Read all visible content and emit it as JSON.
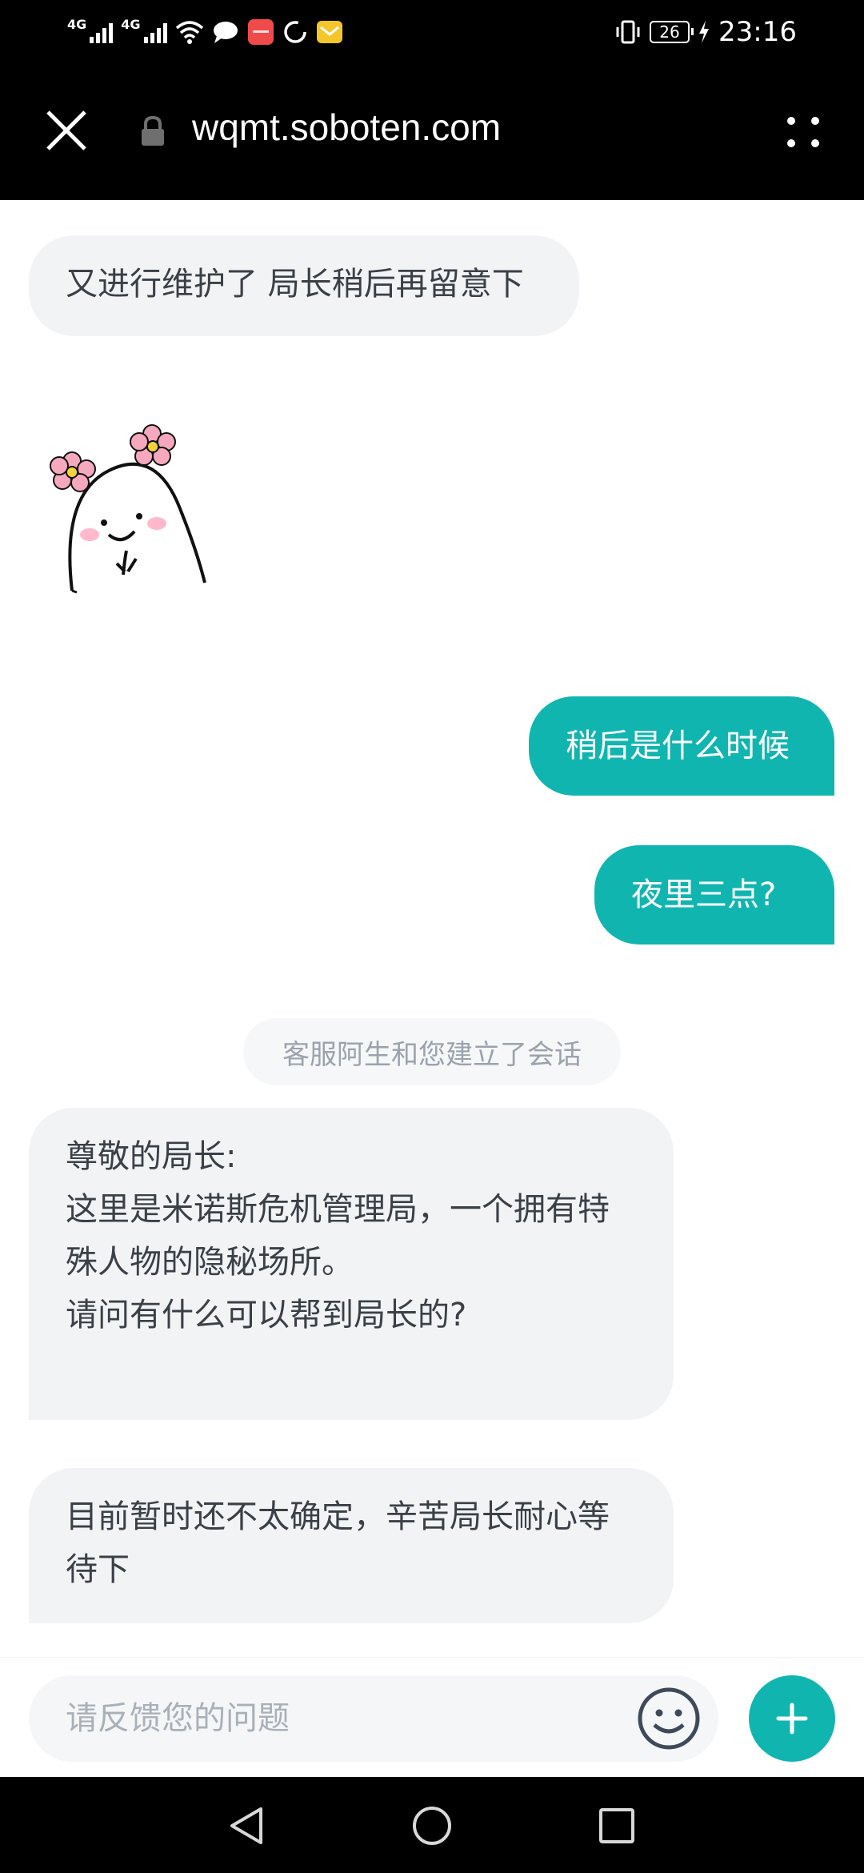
{
  "status_bar": {
    "net1": "4G",
    "net2": "4G",
    "battery": "26",
    "time": "23:16",
    "icons": [
      "signal-icon",
      "wifi-icon",
      "message-icon",
      "huawei-app-icon",
      "sync-icon",
      "email-icon",
      "vibrate-icon",
      "charging-icon"
    ]
  },
  "browser": {
    "url": "wqmt.soboten.com"
  },
  "chat": {
    "messages": [
      {
        "side": "in",
        "text": "又进行维护了 局长稍后再留意下"
      },
      {
        "side": "out",
        "text": "稍后是什么时候"
      },
      {
        "side": "out",
        "text": "夜里三点?"
      },
      {
        "side": "in",
        "text": "目前暂时还不太确定，辛苦局长耐心等待下"
      }
    ],
    "system_notice": "客服阿生和您建立了会话",
    "welcome_lines": [
      "尊敬的局长:",
      "这里是米诺斯危机管理局，一个拥有特",
      "殊人物的隐秘场所。",
      "请问有什么可以帮到局长的?"
    ],
    "last_lines": [
      "目前暂时还不太确定，辛苦局长耐心等",
      "待下"
    ]
  },
  "input": {
    "placeholder": "请反馈您的问题"
  },
  "colors": {
    "accent": "#11b5b0",
    "incoming_bubble": "#f1f3f5",
    "incoming_text": "#3b4047"
  }
}
